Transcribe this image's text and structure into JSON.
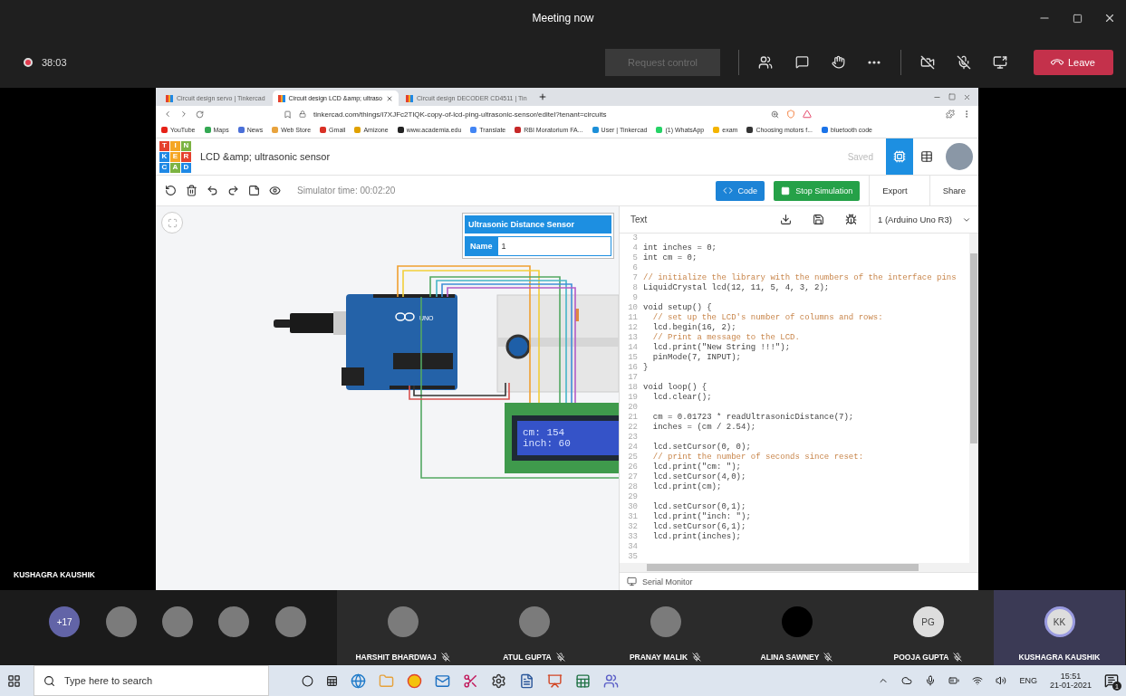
{
  "window": {
    "title": "Meeting now"
  },
  "meeting_bar": {
    "recording": true,
    "timer": "38:03",
    "request_control": {
      "label": "Request control",
      "disabled": true
    },
    "leave": "Leave"
  },
  "presenter": "KUSHAGRA KAUSHIK",
  "browser": {
    "tabs": [
      {
        "label": "Circuit design servo | Tinkercad",
        "selected": false
      },
      {
        "label": "Circuit design LCD &amp; ultraso",
        "selected": true
      },
      {
        "label": "Circuit design DECODER CD4511 | Tin",
        "selected": false
      }
    ],
    "url": "tinkercad.com/things/i7XJFc2TlQK-copy-of-lcd-ping-ultrasonic-sensor/editel?tenant=circuits",
    "bookmarks": [
      {
        "label": "YouTube",
        "color": "#e62117"
      },
      {
        "label": "Maps",
        "color": "#34a853"
      },
      {
        "label": "News",
        "color": "#4a6fd8"
      },
      {
        "label": "Web Store",
        "color": "#e8a33d"
      },
      {
        "label": "Gmail",
        "color": "#d93025"
      },
      {
        "label": "Amizone",
        "color": "#e0a100"
      },
      {
        "label": "www.academia.edu",
        "color": "#222222"
      },
      {
        "label": "Translate",
        "color": "#4285f4"
      },
      {
        "label": "RBI Moratorium FA...",
        "color": "#c62828"
      },
      {
        "label": "User | Tinkercad",
        "color": "#1c8fd8"
      },
      {
        "label": "(1) WhatsApp",
        "color": "#25d366"
      },
      {
        "label": "exam",
        "color": "#f4b400"
      },
      {
        "label": "Choosing motors f...",
        "color": "#333333"
      },
      {
        "label": "bluetooth code",
        "color": "#1a73e8"
      }
    ]
  },
  "tinkercad": {
    "logo_letters": [
      "T",
      "I",
      "N",
      "K",
      "E",
      "R",
      "C",
      "A",
      "D"
    ],
    "title": "LCD &amp; ultrasonic sensor",
    "saved": "Saved",
    "view_buttons": [
      {
        "kind": "circuit",
        "selected": true
      },
      {
        "kind": "list",
        "selected": false
      }
    ],
    "simulator_time": "Simulator time: 00:02:20",
    "code_button": "Code",
    "stop_button": "Stop Simulation",
    "export_button": "Export",
    "share_button": "Share"
  },
  "inspector": {
    "title": "Ultrasonic Distance Sensor",
    "name_label": "Name",
    "name_value": "1"
  },
  "board_label": "UNO",
  "lcd": {
    "lines": [
      "cm: 154",
      "inch: 60"
    ]
  },
  "code_panel": {
    "mode": "Text",
    "device": "1 (Arduino Uno R3)",
    "serial_monitor": "Serial Monitor",
    "lines": [
      {
        "n": "3"
      },
      {
        "n": "4",
        "kind": "code",
        "text": "int inches = 0;"
      },
      {
        "n": "5",
        "kind": "code",
        "text": "int cm = 0;"
      },
      {
        "n": "6"
      },
      {
        "n": "7",
        "kind": "comment",
        "text": "// initialize the library with the numbers of the interface pins"
      },
      {
        "n": "8",
        "kind": "code",
        "text": "LiquidCrystal lcd(12, 11, 5, 4, 3, 2);"
      },
      {
        "n": "9"
      },
      {
        "n": "10",
        "kind": "code",
        "text": "void setup() {"
      },
      {
        "n": "11",
        "kind": "comment",
        "text": "  // set up the LCD's number of columns and rows:"
      },
      {
        "n": "12",
        "kind": "code",
        "text": "  lcd.begin(16, 2);"
      },
      {
        "n": "13",
        "kind": "comment",
        "text": "  // Print a message to the LCD."
      },
      {
        "n": "14",
        "kind": "code",
        "text": "  lcd.print(\"New String !!!\");"
      },
      {
        "n": "15",
        "kind": "code",
        "text": "  pinMode(7, INPUT);"
      },
      {
        "n": "16",
        "kind": "code",
        "text": "}"
      },
      {
        "n": "17"
      },
      {
        "n": "18",
        "kind": "code",
        "text": "void loop() {"
      },
      {
        "n": "19",
        "kind": "code",
        "text": "  lcd.clear();"
      },
      {
        "n": "20"
      },
      {
        "n": "21",
        "kind": "code",
        "text": "  cm = 0.01723 * readUltrasonicDistance(7);"
      },
      {
        "n": "22",
        "kind": "code",
        "text": "  inches = (cm / 2.54);"
      },
      {
        "n": "23"
      },
      {
        "n": "24",
        "kind": "code",
        "text": "  lcd.setCursor(0, 0);"
      },
      {
        "n": "25",
        "kind": "comment",
        "text": "  // print the number of seconds since reset:"
      },
      {
        "n": "26",
        "kind": "code",
        "text": "  lcd.print(\"cm: \");"
      },
      {
        "n": "27",
        "kind": "code",
        "text": "  lcd.setCursor(4,0);"
      },
      {
        "n": "28",
        "kind": "code",
        "text": "  lcd.print(cm);"
      },
      {
        "n": "29"
      },
      {
        "n": "30",
        "kind": "code",
        "text": "  lcd.setCursor(0,1);"
      },
      {
        "n": "31",
        "kind": "code",
        "text": "  lcd.print(\"inch: \");"
      },
      {
        "n": "32",
        "kind": "code",
        "text": "  lcd.setCursor(6,1);"
      },
      {
        "n": "33",
        "kind": "code",
        "text": "  lcd.print(inches);"
      },
      {
        "n": "34"
      },
      {
        "n": "35"
      }
    ]
  },
  "participants": {
    "overflow": [
      {
        "kind": "count",
        "label": "+17"
      },
      {
        "kind": "photo"
      },
      {
        "kind": "photo"
      },
      {
        "kind": "photo"
      },
      {
        "kind": "photo"
      }
    ],
    "tiles": [
      {
        "kind": "photo",
        "name": "HARSHIT BHARDWAJ",
        "muted": true,
        "selected": false
      },
      {
        "kind": "photo",
        "name": "ATUL GUPTA",
        "muted": true,
        "selected": false
      },
      {
        "kind": "photo",
        "name": "PRANAY MALIK",
        "muted": true,
        "selected": false
      },
      {
        "kind": "off",
        "name": "ALINA SAWNEY",
        "muted": true,
        "selected": false
      },
      {
        "kind": "initials",
        "initials": "PG",
        "name": "POOJA GUPTA",
        "muted": true,
        "selected": false
      },
      {
        "kind": "initials",
        "initials": "KK",
        "name": "KUSHAGRA KAUSHIK",
        "muted": false,
        "selected": true
      }
    ]
  },
  "taskbar": {
    "search_placeholder": "Type here to search",
    "language": "ENG",
    "time": "15:51",
    "date": "21-01-2021",
    "notifications": "1"
  }
}
